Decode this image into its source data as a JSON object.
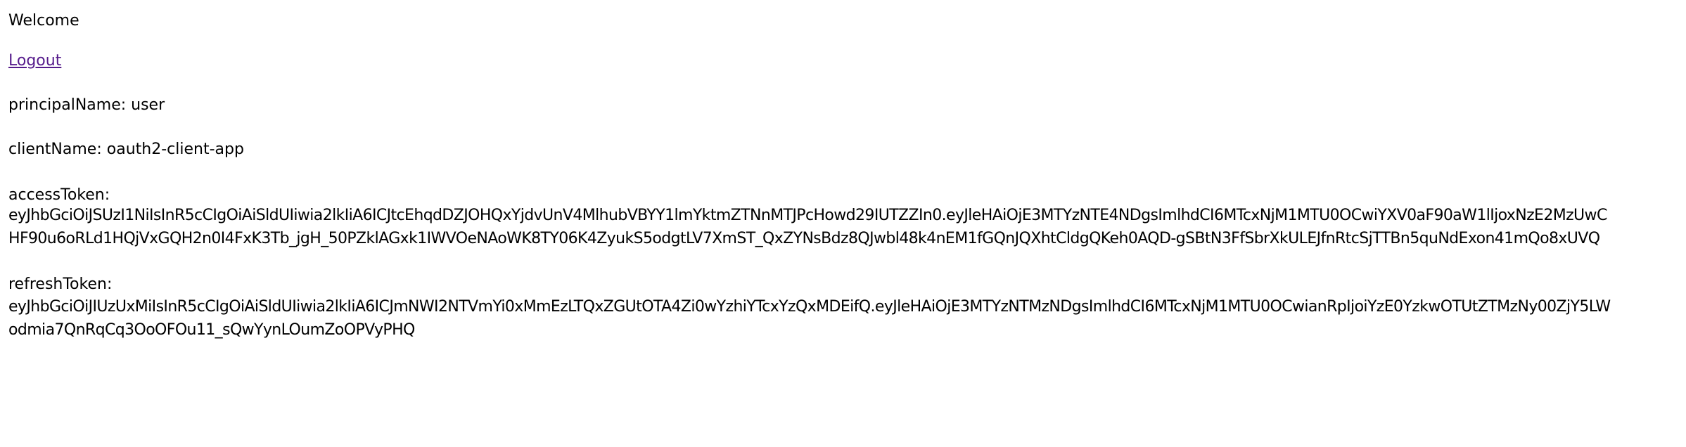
{
  "welcome": "Welcome",
  "logout_label": "Logout",
  "principal": {
    "label": "principalName:",
    "value": "user"
  },
  "client": {
    "label": "clientName:",
    "value": "oauth2-client-app"
  },
  "access_token": {
    "label": "accessToken:",
    "line1": "eyJhbGciOiJSUzI1NiIsInR5cCIgOiAiSldUIiwia2lkIiA6ICJtcEhqdDZJOHQxYjdvUnV4MlhubVBYY1lmYktmZTNnMTJPcHowd29IUTZZIn0.eyJleHAiOjE3MTYzNTE4NDgsImlhdCI6MTcxNjM1MTU0OCwiYXV0aF90aW1lIjoxNzE2MzUwC",
    "line2": "HF90u6oRLd1HQjVxGQH2n0I4FxK3Tb_jgH_50PZklAGxk1IWVOeNAoWK8TY06K4ZyukS5odgtLV7XmST_QxZYNsBdz8QJwbl48k4nEM1fGQnJQXhtCldgQKeh0AQD-gSBtN3FfSbrXkULEJfnRtcSjTTBn5quNdExon41mQo8xUVQ"
  },
  "refresh_token": {
    "label": "refreshToken:",
    "line1": "eyJhbGciOiJIUzUxMiIsInR5cCIgOiAiSldUIiwia2lkIiA6ICJmNWI2NTVmYi0xMmEzLTQxZGUtOTA4Zi0wYzhiYTcxYzQxMDEifQ.eyJleHAiOjE3MTYzNTMzNDgsImlhdCI6MTcxNjM1MTU0OCwianRpIjoiYzE0YzkwOTUtZTMzNy00ZjY5LW",
    "line2": "odmia7QnRqCq3OoOFOu11_sQwYynLOumZoOPVyPHQ"
  }
}
